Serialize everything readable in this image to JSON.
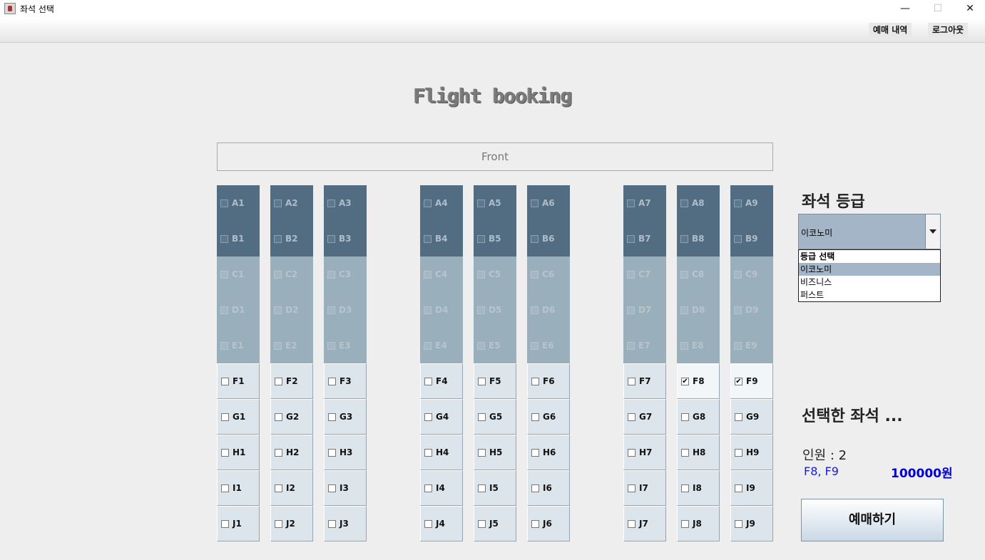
{
  "window": {
    "title": "좌석 선택",
    "minimize": "—",
    "maximize": "☐",
    "close": "✕"
  },
  "menu": {
    "history": "예매 내역",
    "logout": "로그아웃"
  },
  "page_title": "Flight booking",
  "front_label": "Front",
  "seats": [
    [
      "A1",
      "A2",
      "A3",
      "A4",
      "A5",
      "A6",
      "A7",
      "A8",
      "A9"
    ],
    [
      "B1",
      "B2",
      "B3",
      "B4",
      "B5",
      "B6",
      "B7",
      "B8",
      "B9"
    ],
    [
      "C1",
      "C2",
      "C3",
      "C4",
      "C5",
      "C6",
      "C7",
      "C8",
      "C9"
    ],
    [
      "D1",
      "D2",
      "D3",
      "D4",
      "D5",
      "D6",
      "D7",
      "D8",
      "D9"
    ],
    [
      "E1",
      "E2",
      "E3",
      "E4",
      "E5",
      "E6",
      "E7",
      "E8",
      "E9"
    ],
    [
      "F1",
      "F2",
      "F3",
      "F4",
      "F5",
      "F6",
      "F7",
      "F8",
      "F9"
    ],
    [
      "G1",
      "G2",
      "G3",
      "G4",
      "G5",
      "G6",
      "G7",
      "G8",
      "G9"
    ],
    [
      "H1",
      "H2",
      "H3",
      "H4",
      "H5",
      "H6",
      "H7",
      "H8",
      "H9"
    ],
    [
      "I1",
      "I2",
      "I3",
      "I4",
      "I5",
      "I6",
      "I7",
      "I8",
      "I9"
    ],
    [
      "J1",
      "J2",
      "J3",
      "J4",
      "J5",
      "J6",
      "J7",
      "J8",
      "J9"
    ]
  ],
  "row_classes": [
    "first",
    "first",
    "business",
    "business",
    "business",
    "economy",
    "economy",
    "economy",
    "economy",
    "economy"
  ],
  "checked_seats": [
    "F8",
    "F9"
  ],
  "grade": {
    "title": "좌석 등급",
    "selected": "이코노미",
    "options": [
      "등급 선택",
      "이코노미",
      "비즈니스",
      "퍼스트"
    ]
  },
  "selection": {
    "title": "선택한 좌석 ...",
    "count_text": "인원 : 2",
    "seats_text": "F8, F9",
    "price_text": "100000원"
  },
  "book_button": "예매하기",
  "colors": {
    "first": "#526c82",
    "business": "#9aafbc",
    "economy": "#dde5ec",
    "price": "#0000d0"
  }
}
